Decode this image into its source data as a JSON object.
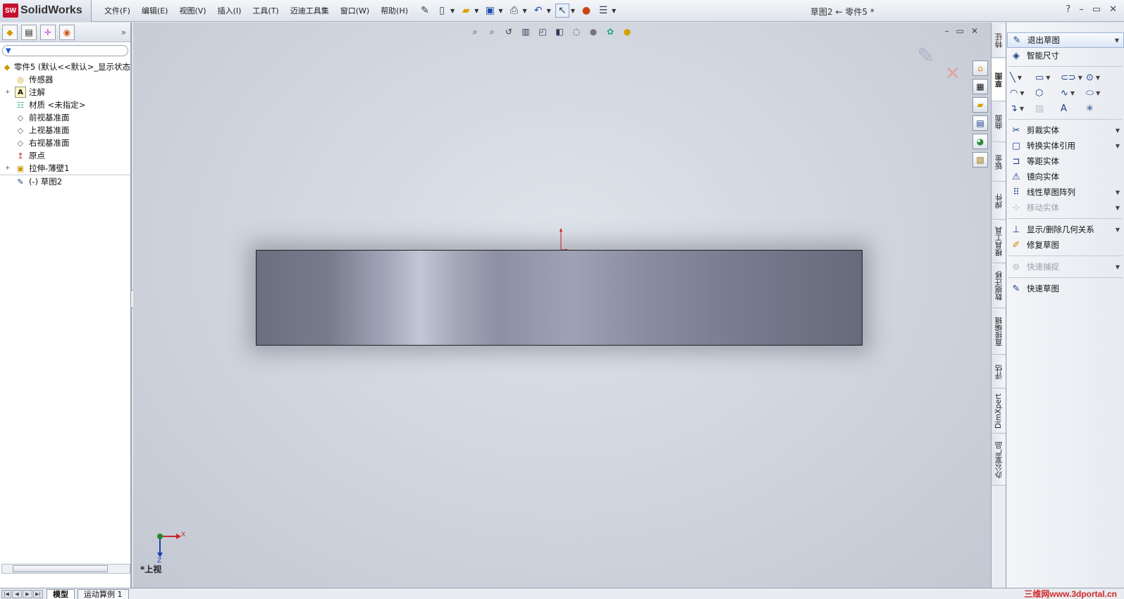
{
  "app": {
    "logo_text": "SolidWorks",
    "badge": "SW"
  },
  "menu": [
    "文件(F)",
    "编辑(E)",
    "视图(V)",
    "插入(I)",
    "工具(T)",
    "迈迪工具集",
    "窗口(W)",
    "帮助(H)"
  ],
  "window_title": "草图2 ← 零件5 *",
  "window_controls": {
    "help": "?",
    "minimize": "–",
    "restore": "▭",
    "close": "✕"
  },
  "feature_tree": {
    "root": "零件5 (默认<<默认>_显示状态",
    "items": [
      {
        "label": "传感器",
        "icon": "sensor-icon"
      },
      {
        "label": "注解",
        "icon": "annotation-icon",
        "expand": "+"
      },
      {
        "label": "材质 <未指定>",
        "icon": "material-icon"
      },
      {
        "label": "前视基准面",
        "icon": "plane-icon"
      },
      {
        "label": "上视基准面",
        "icon": "plane-icon"
      },
      {
        "label": "右视基准面",
        "icon": "plane-icon"
      },
      {
        "label": "原点",
        "icon": "origin-icon"
      },
      {
        "label": "拉伸-薄壁1",
        "icon": "extrude-icon",
        "expand": "+"
      },
      {
        "label": "(-) 草图2",
        "icon": "sketch-icon"
      }
    ],
    "more": "»"
  },
  "viewport": {
    "view_label": "*上视",
    "triad_x": "X",
    "triad_z": "Z"
  },
  "vertical_tabs": [
    {
      "label": "特征"
    },
    {
      "label": "草图",
      "active": true
    },
    {
      "label": "曲面"
    },
    {
      "label": "钣金"
    },
    {
      "label": "焊件"
    },
    {
      "label": "模具工具"
    },
    {
      "label": "数据迁移"
    },
    {
      "label": "直接编辑"
    },
    {
      "label": "评估"
    },
    {
      "label": "DimXpert"
    },
    {
      "label": "办公室产品"
    }
  ],
  "sketch_commands": {
    "exit_sketch": "退出草图",
    "smart_dimension": "智能尺寸",
    "trim": "剪裁实体",
    "convert": "转换实体引用",
    "offset": "等距实体",
    "mirror": "镜向实体",
    "linear_pattern": "线性草图阵列",
    "move": "移动实体",
    "relations": "显示/删除几何关系",
    "repair": "修复草图",
    "quick_snaps": "快速捕捉",
    "rapid_sketch": "快速草图"
  },
  "bottom_tabs": [
    "模型",
    "运动算例 1"
  ],
  "watermark": "三维网www.3dportal.cn"
}
